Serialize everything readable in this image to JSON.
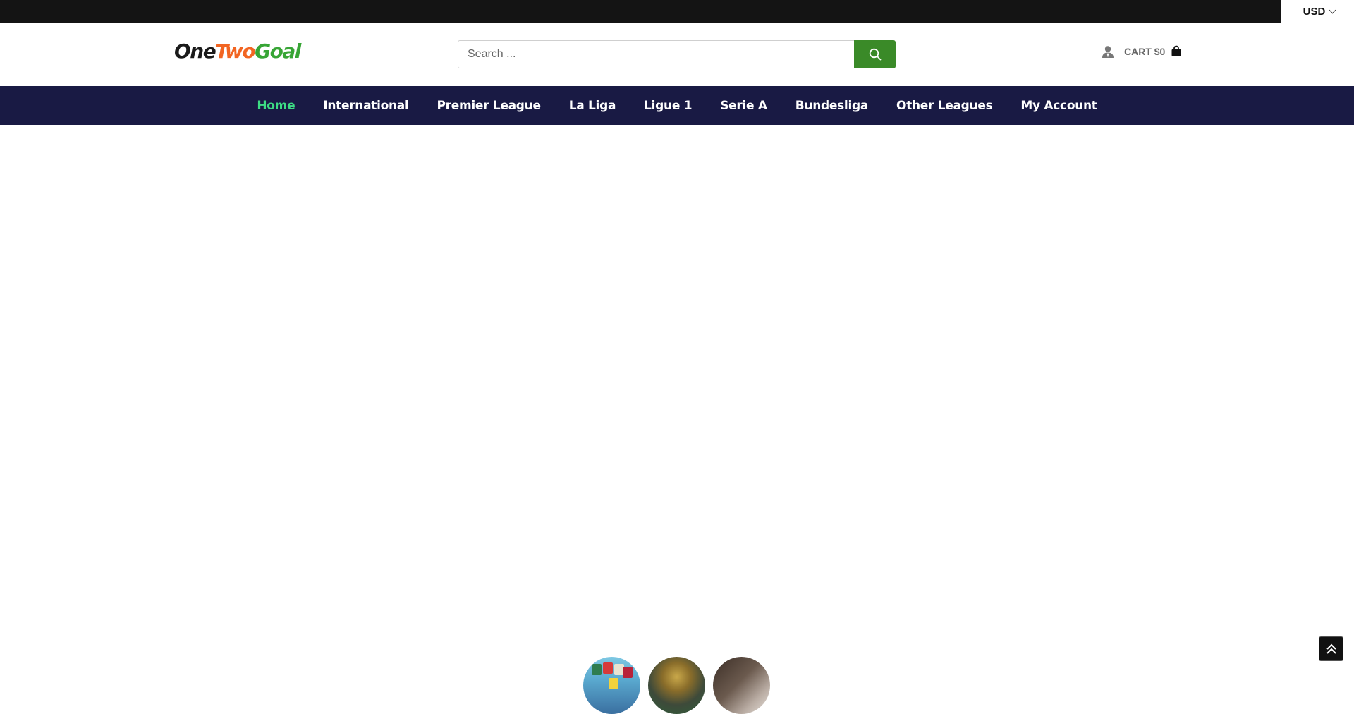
{
  "topbar": {
    "currency": "USD"
  },
  "header": {
    "logo": {
      "one": "One",
      "two": "Two",
      "goal": "Goal"
    },
    "search": {
      "placeholder": "Search ..."
    },
    "cart_label": "CART $0"
  },
  "nav": {
    "items": [
      {
        "label": "Home",
        "active": true
      },
      {
        "label": "International"
      },
      {
        "label": "Premier League"
      },
      {
        "label": "La Liga"
      },
      {
        "label": "Ligue 1"
      },
      {
        "label": "Serie A"
      },
      {
        "label": "Bundesliga"
      },
      {
        "label": "Other Leagues"
      },
      {
        "label": "My Account"
      }
    ]
  },
  "colors": {
    "topbar": "#141414",
    "nav_bg": "#191a44",
    "nav_active": "#3ddc84",
    "search_button": "#3a8a28",
    "logo_two": "#f26522",
    "logo_goal": "#37a535"
  },
  "icons": {
    "search": "search-icon",
    "account": "user-icon",
    "cart": "shopping-bag-icon",
    "scroll_top": "double-chevron-up-icon",
    "currency_toggle": "chevron-down-icon"
  }
}
